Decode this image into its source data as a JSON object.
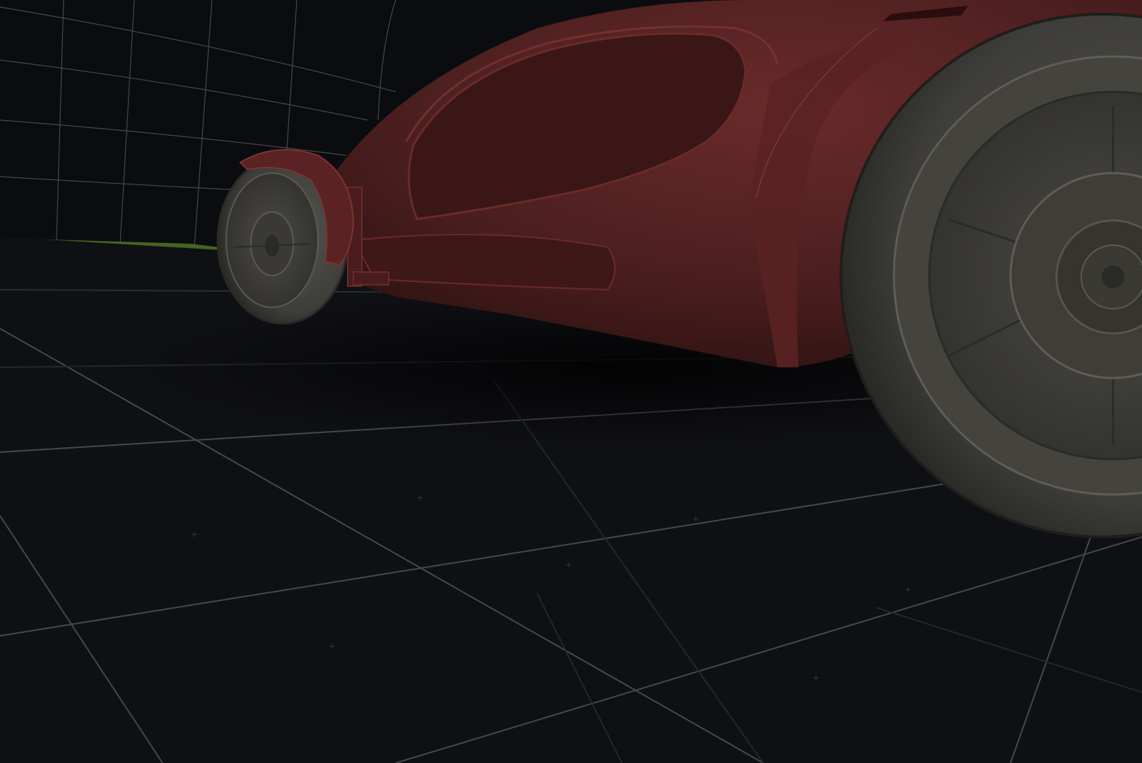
{
  "viewport": {
    "background": "#0b0c10",
    "grid_line_color": "#5a5e66",
    "backdrop_grid_color": "#6e7078",
    "car_body_color": "#5a2424",
    "car_body_highlight": "#7a3434",
    "tire_color": "#4b4a45",
    "rim_color": "#5c5b55",
    "horizon_accent_color": "#4c6e22"
  },
  "scene": {
    "objects": [
      {
        "name": "car-body",
        "icon": "car-icon"
      },
      {
        "name": "front-wheel",
        "icon": "wheel-icon"
      },
      {
        "name": "rear-wheel",
        "icon": "wheel-icon"
      },
      {
        "name": "ground-grid",
        "icon": "grid-icon"
      },
      {
        "name": "backdrop-grid",
        "icon": "grid-icon"
      }
    ]
  }
}
